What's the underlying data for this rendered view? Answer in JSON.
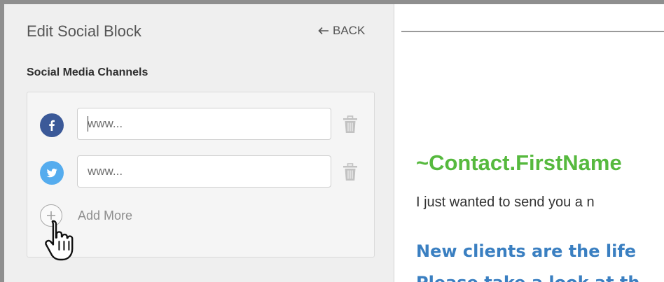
{
  "editor": {
    "title": "Edit Social Block",
    "back_label": "BACK",
    "section_title": "Social Media Channels",
    "channels": [
      {
        "network": "facebook",
        "icon": "facebook-icon",
        "color": "#3b5998",
        "placeholder": "www..."
      },
      {
        "network": "twitter",
        "icon": "twitter-icon",
        "color": "#55acee",
        "placeholder": "www..."
      }
    ],
    "add_more_label": "Add More"
  },
  "preview": {
    "greeting": "~Contact.FirstName",
    "body_line": "I just wanted to send you a n",
    "heading_line1": "New clients are the life",
    "heading_line2": "Please take a look at th",
    "colors": {
      "greeting": "#56b93e",
      "heading": "#3a7fc1"
    }
  }
}
